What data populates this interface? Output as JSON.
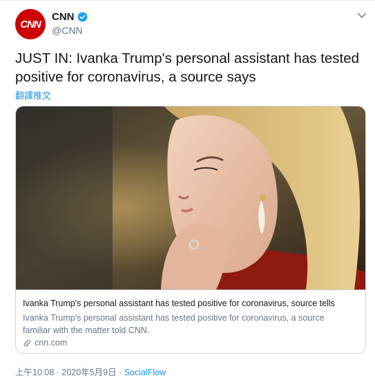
{
  "author": {
    "avatar_text": "CNN",
    "name": "CNN",
    "handle": "@CNN"
  },
  "tweet": {
    "text": "JUST IN: Ivanka Trump's personal assistant has tested positive for coronavirus, a source says",
    "translate_label": "翻譯推文"
  },
  "card": {
    "title": "Ivanka Trump's personal assistant has tested positive for coronavirus, source tells",
    "description": "Ivanka Trump's personal assistant has tested positive for coronavirus, a source familiar with the matter told CNN.",
    "domain": "cnn.com"
  },
  "meta": {
    "time": "上午10:08",
    "separator": " · ",
    "date": "2020年5月9日",
    "separator2": " · ",
    "source": "SocialFlow"
  },
  "colors": {
    "accent": "#1b95e0",
    "brand": "#cc0000",
    "muted": "#657786"
  }
}
